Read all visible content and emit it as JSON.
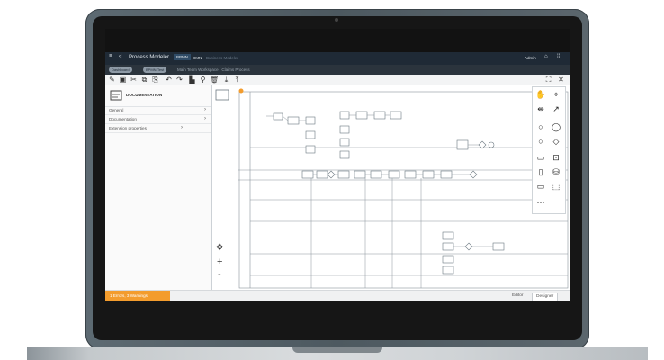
{
  "app": {
    "title": "Process Modeler",
    "header_tabs": [
      "BPMN",
      "DMN",
      "Business Modeler"
    ],
    "user_label": "Admin",
    "icons": {
      "menu": "hamburger-icon",
      "home": "home-icon",
      "grid": "apps-grid-icon"
    }
  },
  "breadcrumbs": {
    "pills": [
      "Dashboard",
      "BPMN-Test"
    ],
    "path": "Main Team Workspace / Claims Process"
  },
  "toolbar": {
    "tools": [
      "pencil-icon",
      "save-icon",
      "cut-icon",
      "copy-icon",
      "paste-icon",
      "undo-icon",
      "redo-icon",
      "format-icon",
      "zoom-icon",
      "delete-icon",
      "download-icon",
      "upload-icon"
    ],
    "right_tools": [
      "fullscreen-icon",
      "close-icon"
    ]
  },
  "properties_panel": {
    "element_title": "DOCUMENTATION",
    "rows": [
      {
        "label": "General",
        "value": ""
      },
      {
        "label": "Documentation",
        "value": ""
      },
      {
        "label": "Extension properties",
        "value": ""
      }
    ]
  },
  "canvas": {
    "zoom_controls": [
      "+",
      "-"
    ]
  },
  "palette": {
    "items": [
      "hand-tool-icon",
      "lasso-tool-icon",
      "space-tool-icon",
      "connect-tool-icon",
      "start-event-icon",
      "intermediate-event-icon",
      "end-event-icon",
      "gateway-icon",
      "task-icon",
      "subprocess-icon",
      "data-object-icon",
      "data-store-icon",
      "pool-icon",
      "group-icon",
      "more-icon"
    ]
  },
  "status_bar": {
    "warning": "1 Errors, 3 Warnings",
    "tabs": [
      "Editor",
      "Designer"
    ],
    "active_tab": "Designer"
  },
  "colors": {
    "accent": "#f39c2d",
    "header": "#1f2a36",
    "bezel": "#161616",
    "shell": "#55616a"
  }
}
